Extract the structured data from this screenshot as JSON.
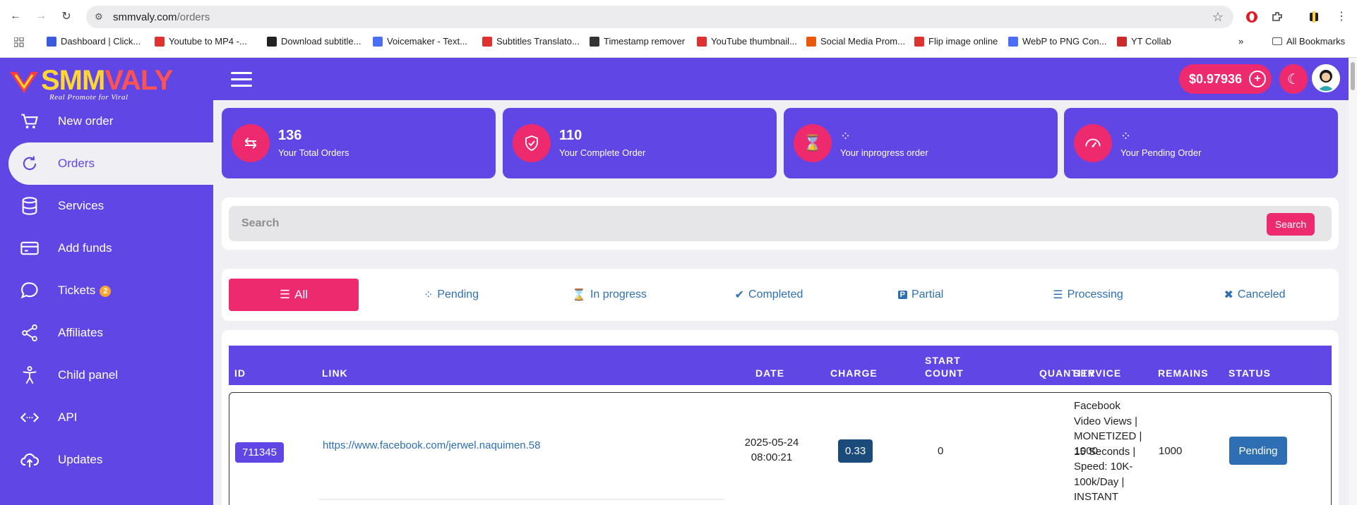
{
  "browser": {
    "url_host": "smmvaly.com",
    "url_path": "/orders",
    "bookmarks": [
      {
        "label": "Dashboard | Click...",
        "color": "#3b5bdb"
      },
      {
        "label": "Youtube to MP4 -...",
        "color": "#e03131"
      },
      {
        "label": "Download subtitle...",
        "color": "#222222"
      },
      {
        "label": "Voicemaker - Text...",
        "color": "#4c6ef5"
      },
      {
        "label": "Subtitles Translato...",
        "color": "#e03131"
      },
      {
        "label": "Timestamp remover",
        "color": "#333333"
      },
      {
        "label": "YouTube thumbnail...",
        "color": "#e03131"
      },
      {
        "label": "Social Media Prom...",
        "color": "#e8590c"
      },
      {
        "label": "Flip image online",
        "color": "#e03131"
      },
      {
        "label": "WebP to PNG Con...",
        "color": "#4c6ef5"
      },
      {
        "label": "YT Collab",
        "color": "#c92a2a"
      }
    ],
    "more": "»",
    "all_bookmarks": "All Bookmarks"
  },
  "brand": {
    "name_part1": "SMM",
    "name_part2": "VALY",
    "tagline": "Real Promote for Viral"
  },
  "header": {
    "balance": "$0.97936"
  },
  "sidebar": {
    "items": [
      {
        "label": "New order",
        "icon": "cart-icon"
      },
      {
        "label": "Orders",
        "icon": "refresh-icon"
      },
      {
        "label": "Services",
        "icon": "database-icon"
      },
      {
        "label": "Add funds",
        "icon": "card-icon"
      },
      {
        "label": "Tickets",
        "icon": "chat-icon",
        "badge": "2"
      },
      {
        "label": "Affiliates",
        "icon": "share-icon"
      },
      {
        "label": "Child panel",
        "icon": "person-icon"
      },
      {
        "label": "API",
        "icon": "code-icon"
      },
      {
        "label": "Updates",
        "icon": "cloud-upload-icon"
      }
    ]
  },
  "stats": [
    {
      "value": "136",
      "caption": "Your Total Orders",
      "icon": "swap-icon"
    },
    {
      "value": "110",
      "caption": "Your Complete Order",
      "icon": "shield-check-icon"
    },
    {
      "value": "",
      "caption": "Your inprogress order",
      "icon": "hourglass-icon"
    },
    {
      "value": "",
      "caption": "Your Pending Order",
      "icon": "speedometer-icon"
    }
  ],
  "search": {
    "placeholder": "Search",
    "button": "Search"
  },
  "tabs": [
    {
      "label": "All",
      "icon": "list-icon"
    },
    {
      "label": "Pending",
      "icon": "spinner-icon"
    },
    {
      "label": "In progress",
      "icon": "hourglass-icon"
    },
    {
      "label": "Completed",
      "icon": "check-double-icon"
    },
    {
      "label": "Partial",
      "icon": "p-square-icon"
    },
    {
      "label": "Processing",
      "icon": "checklist-icon"
    },
    {
      "label": "Canceled",
      "icon": "x-icon"
    }
  ],
  "table": {
    "headers": {
      "id": "ID",
      "link": "LINK",
      "date": "DATE",
      "charge": "CHARGE",
      "start_count_1": "START",
      "start_count_2": "COUNT",
      "quantity": "QUANTITY",
      "service": "SERVICE",
      "remains": "REMAINS",
      "status": "STATUS"
    },
    "rows": [
      {
        "id": "711345",
        "link": "https://www.facebook.com/jerwel.naquimen.58",
        "date_line1": "2025-05-24",
        "date_line2": "08:00:21",
        "charge": "0.33",
        "start_count": "0",
        "quantity": "1000",
        "service": "Facebook Video Views | MONETIZED | 15 Seconds | Speed: 10K-100k/Day | INSTANT",
        "remains": "1000",
        "status": "Pending"
      }
    ]
  },
  "colors": {
    "primary": "#6146e6",
    "accent": "#ee2a6e",
    "link": "#2e6fb4",
    "charge_bg": "#1b4b7a"
  }
}
